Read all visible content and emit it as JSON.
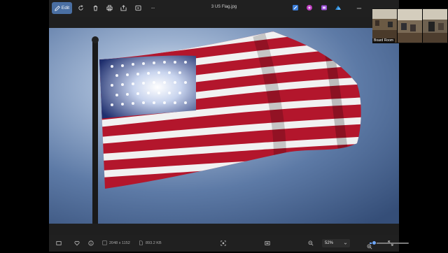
{
  "titlebar": {
    "edit_label": "Edit",
    "file_title": "3 US Flag.jpg",
    "more_glyph": "···"
  },
  "icons": {
    "edit": "pencil-icon",
    "rotate": "rotate-icon",
    "delete": "trash-icon",
    "print": "print-icon",
    "share": "share-icon",
    "slideshow": "slideshow-icon",
    "more": "more-icon"
  },
  "image": {
    "subject": "US flag"
  },
  "statusbar": {
    "dimensions": "2048 x 1152",
    "file_size": "893.2 KB",
    "zoom": "52%"
  },
  "zoom": {
    "level_fraction": 0.11
  },
  "meeting": {
    "room_label": "Board Room"
  },
  "colors": {
    "accent": "#6fa8ff",
    "edit_bg": "#4a6fa3",
    "app_bg": "#1f1f1f"
  }
}
